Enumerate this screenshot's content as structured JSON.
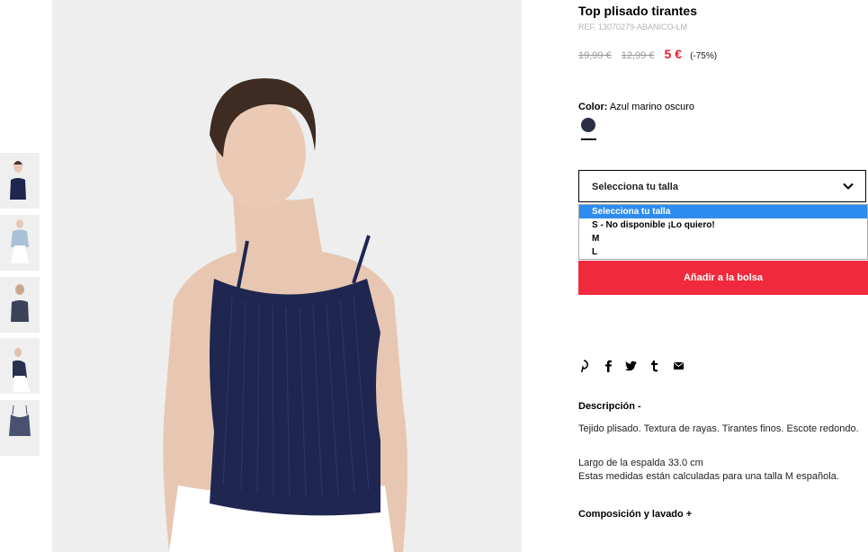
{
  "product": {
    "title": "Top plisado tirantes",
    "ref": "REF. 13070279-ABANICO-LM",
    "old_price_1": "19,99 €",
    "old_price_2": "12,99 €",
    "price": "5 €",
    "discount": "(-75%)"
  },
  "color": {
    "label": "Color:",
    "value": "Azul marino oscuro",
    "swatch_hex": "#2a2f45"
  },
  "size_select": {
    "label": "Selecciona tu talla",
    "options": [
      "Selecciona tu talla",
      "S - No disponible ¡Lo quiero!",
      "M",
      "L"
    ]
  },
  "add_button": "Añadir a la bolsa",
  "social": [
    "pinterest-icon",
    "facebook-icon",
    "twitter-icon",
    "tumblr-icon",
    "email-icon"
  ],
  "description": {
    "heading": "Descripción -",
    "text1": "Tejido plisado. Textura de rayas. Tirantes finos. Escote redondo.",
    "text2": "Largo de la espalda 33.0 cm",
    "text3": "Estas medidas están calculadas para una talla M española."
  },
  "composition_heading": "Composición y lavado +",
  "colors": {
    "accent_red": "#f02a3c",
    "price_red": "#e3202e",
    "select_highlight": "#2d8cf0",
    "garment_navy": "#1f2650"
  }
}
